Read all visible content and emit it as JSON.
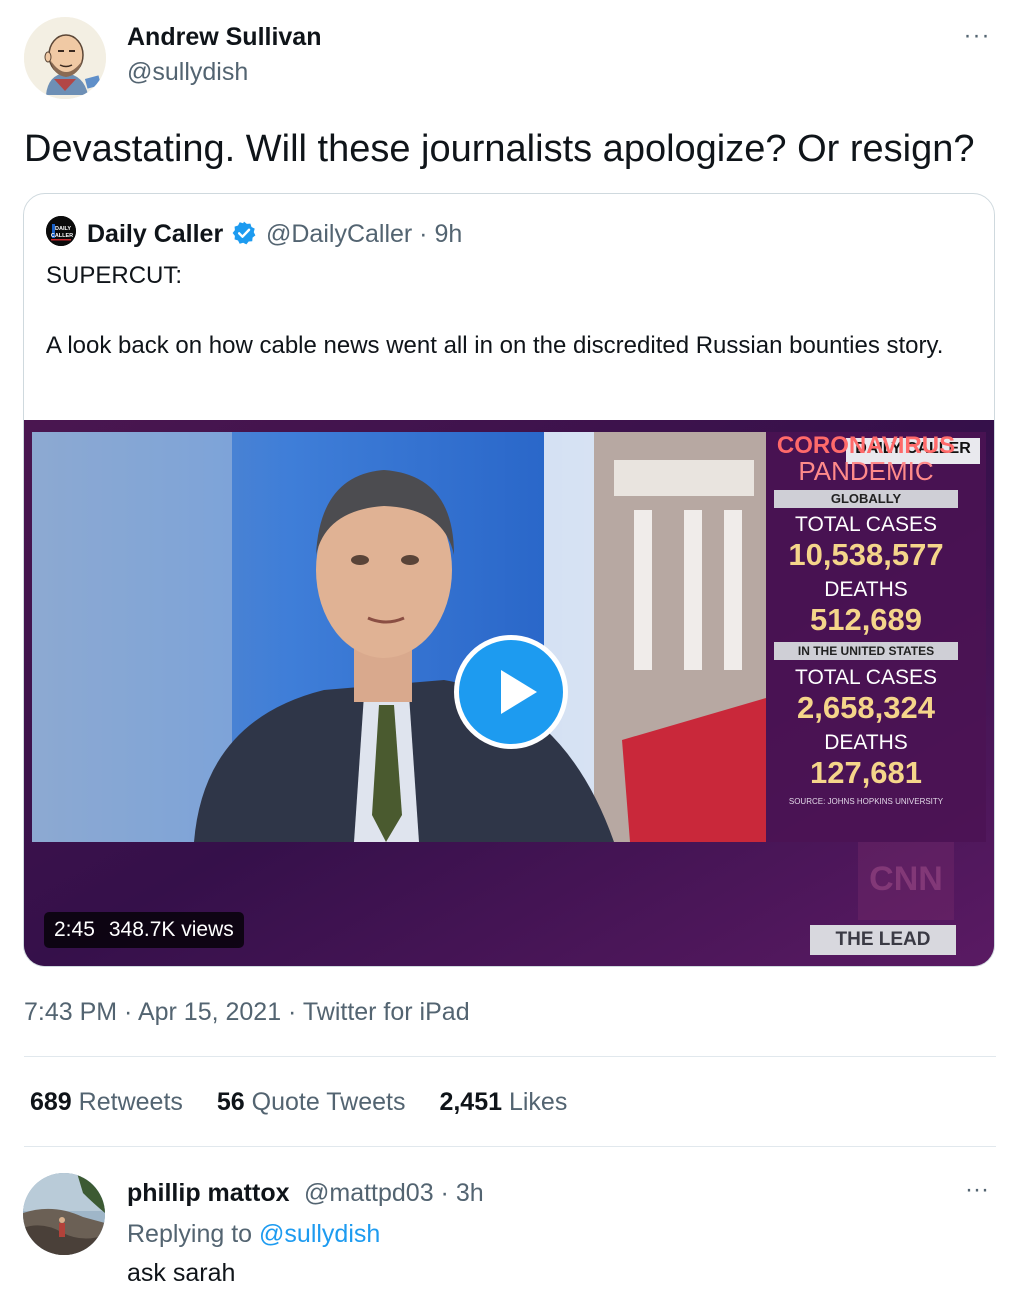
{
  "tweet": {
    "author_name": "Andrew Sullivan",
    "author_handle": "@sullydish",
    "more_label": "···",
    "text": "Devastating. Will these journalists apologize? Or resign?",
    "timestamp": "7:43 PM · Apr 15, 2021 · Twitter for iPad"
  },
  "quote": {
    "author_name": "Daily Caller",
    "author_handle_time": "@DailyCaller · 9h",
    "avatar_text": "DAILY CALLER",
    "text_line1": "SUPERCUT:",
    "text_line2": "A look back on how cable news went all in on the discredited Russian bounties story.",
    "video": {
      "duration": "2:45",
      "views": "348.7K views",
      "overlay": {
        "watermark": "DAILY CALLER",
        "headline1": "CORONAVIRUS",
        "headline2": "PANDEMIC",
        "globally": "GLOBALLY",
        "total_cases_label": "TOTAL CASES",
        "global_cases": "10,538,577",
        "deaths_label": "DEATHS",
        "global_deaths": "512,689",
        "us_label": "IN THE UNITED STATES",
        "us_cases": "2,658,324",
        "us_deaths": "127,681",
        "source": "SOURCE: JOHNS HOPKINS UNIVERSITY",
        "network": "CNN",
        "show": "THE LEAD"
      }
    }
  },
  "stats": {
    "retweets_count": "689",
    "retweets_label": "Retweets",
    "quotes_count": "56",
    "quotes_label": "Quote Tweets",
    "likes_count": "2,451",
    "likes_label": "Likes"
  },
  "reply": {
    "author_name": "phillip mattox",
    "author_handle_time": "@mattpd03 · 3h",
    "more_label": "···",
    "replying_prefix": "Replying to",
    "replying_to": "@sullydish",
    "text": "ask sarah"
  },
  "colors": {
    "accent": "#1d9bf0",
    "secondary_text": "#536471",
    "primary_text": "#0f1419"
  }
}
